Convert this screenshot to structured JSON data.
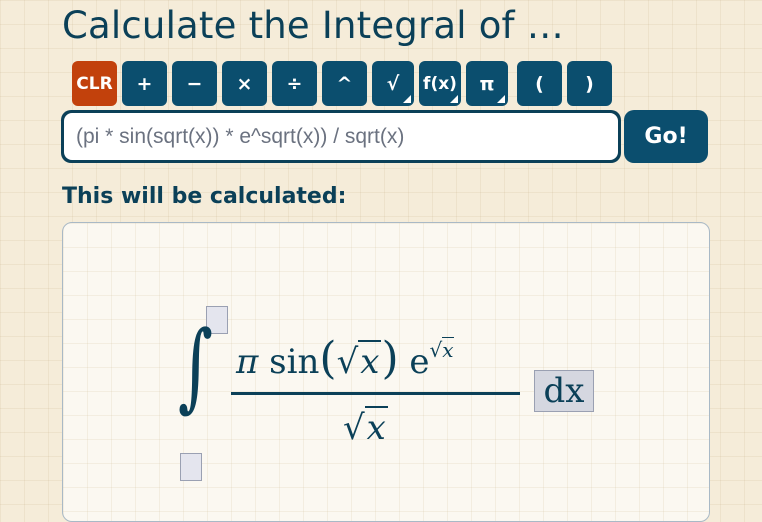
{
  "header": {
    "title": "Calculate the Integral of …"
  },
  "toolbar": {
    "buttons": [
      {
        "label": "CLR"
      },
      {
        "label": "+"
      },
      {
        "label": "−"
      },
      {
        "label": "×"
      },
      {
        "label": "÷"
      },
      {
        "label": "^"
      },
      {
        "label": "√"
      },
      {
        "label": "f(x)"
      },
      {
        "label": "π"
      },
      {
        "label": "("
      },
      {
        "label": ")"
      }
    ]
  },
  "expression": {
    "value": "(pi * sin(sqrt(x)) * e^sqrt(x)) / sqrt(x)",
    "go_label": "Go!"
  },
  "preview": {
    "heading": "This will be calculated:",
    "integral_sign": "∫",
    "numerator": {
      "pi": "π",
      "sin": "sin",
      "x": "x",
      "e": "e",
      "exp_x": "x"
    },
    "denominator": {
      "x": "x"
    },
    "differential": "dx"
  },
  "colors": {
    "primary": "#0b4e6e",
    "clear": "#c2410c",
    "background": "#f5ecd9"
  }
}
